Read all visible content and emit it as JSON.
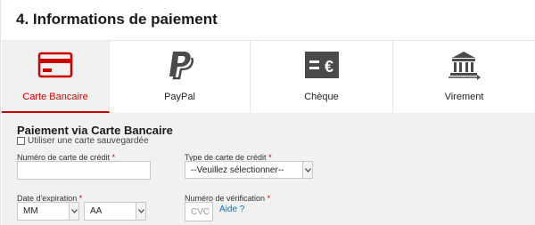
{
  "section": {
    "title": "4. Informations de paiement"
  },
  "tabs": [
    {
      "label": "Carte Bancaire",
      "icon": "credit-card-icon",
      "active": true
    },
    {
      "label": "PayPal",
      "icon": "paypal-icon",
      "active": false
    },
    {
      "label": "Chèque",
      "icon": "cheque-icon",
      "active": false
    },
    {
      "label": "Virement",
      "icon": "bank-transfer-icon",
      "active": false
    }
  ],
  "form": {
    "title": "Paiement via Carte Bancaire",
    "saved_card_label": "Utiliser une carte sauvegardée",
    "card_number": {
      "label": "Numéro de carte de crédit",
      "required_mark": "*",
      "value": ""
    },
    "card_type": {
      "label": "Type de carte de crédit",
      "required_mark": "*",
      "selected": "--Veuillez sélectionner--"
    },
    "expiration": {
      "label": "Date d'expiration",
      "required_mark": "*",
      "month": "MM",
      "year": "AA"
    },
    "verification": {
      "label": "Numéro de vérification",
      "required_mark": "*",
      "placeholder": "CVC",
      "help_link": "Aide ?"
    }
  },
  "colors": {
    "accent": "#cc0000",
    "icon_dark": "#4a4a4a",
    "link": "#0b6fc6",
    "form_bg": "#f1f1f1"
  }
}
